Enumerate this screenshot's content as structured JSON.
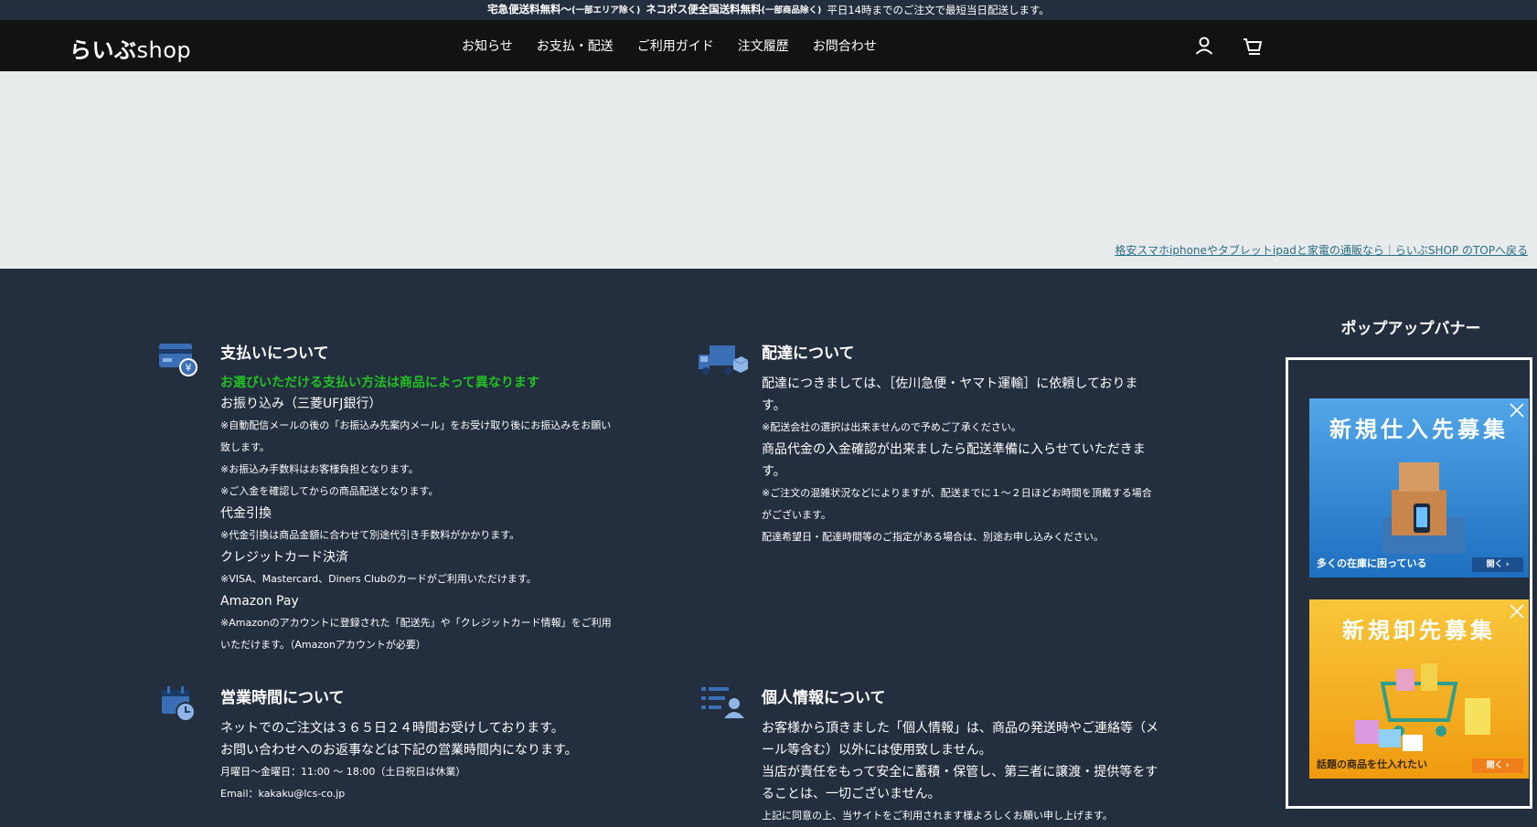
{
  "topbar": {
    "part1": "宅急便送料無料〜",
    "part1_small": "(一部エリア除く)",
    "part2": "ネコポス便全国送料無料",
    "part2_small": "(一部商品除く)",
    "part3": "平日14時までのご注文で最短当日配送します。"
  },
  "header": {
    "logo_jp": "らいぶ",
    "logo_en": "shop",
    "menu": [
      "お知らせ",
      "お支払・配送",
      "ご利用ガイド",
      "注文履歴",
      "お問合わせ"
    ],
    "icons": [
      "user-icon",
      "cart-icon"
    ]
  },
  "hero": {
    "link_text": "格安スマホiphoneやタブレットipadと家電の通販なら｜らいぶSHOP のTOPへ戻る"
  },
  "payment": {
    "title": "支払いについて",
    "highlight": "お選びいただける支払い方法は商品によって異なります",
    "bank_title": "お振り込み（三菱UFJ銀行）",
    "bank_note1a": "※自動配信メールの後の「お振込み先案内メール」をお受け取り後にお振込みをお願い",
    "bank_note1b": "致します。",
    "bank_note2": "※お振込み手数料はお客様負担となります。",
    "bank_note3": "※ご入金を確認してからの商品配送となります。",
    "cod_title": "代金引換",
    "cod_note": "※代金引換は商品金額に合わせて別途代引き手数料がかかります。",
    "card_title": "クレジットカード決済",
    "card_note": "※VISA、Mastercard、Diners Clubのカードがご利用いただけます。",
    "amazon_title": "Amazon Pay",
    "amazon_note_a": "※Amazonのアカウントに登録された「配送先」や「クレジットカード情報」をご利用",
    "amazon_note_b": "いただけます。（Amazonアカウントが必要）",
    "icon": "credit-card-yen-icon"
  },
  "delivery": {
    "title": "配達について",
    "line1a": "配達につきましては、［佐川急便・ヤマト運輸］に依頼しておりま",
    "line1b": "す。",
    "note1": "※配送会社の選択は出来ませんので予めご了承ください。",
    "line2a": "商品代金の入金確認が出来ましたら配送準備に入らせていただきま",
    "line2b": "す。",
    "note2a": "※ご注文の混雑状況などによりますが、配送までに１〜２日ほどお時間を頂戴する場合",
    "note2b": "がございます。",
    "note3": "配達希望日・配達時間等のご指定がある場合は、別途お申し込みください。",
    "icon": "truck-icon"
  },
  "hours": {
    "title": "営業時間について",
    "line1": "ネットでのご注文は３６５日２４時間お受けしております。",
    "line2": "お問い合わせへのお返事などは下記の営業時間内になります。",
    "line3": "月曜日〜金曜日：11:00 〜 18:00（土日祝日は休業）",
    "line4": "Email：kakaku@lcs-co.jp",
    "icon": "calendar-clock-icon"
  },
  "privacy": {
    "title": "個人情報について",
    "line1a": "お客様から頂きました「個人情報」は、商品の発送時やご連絡等（メ",
    "line1b": "ール等含む）以外には使用致しません。",
    "line2a": "当店が責任をもって安全に蓄積・保管し、第三者に譲渡・提供等をす",
    "line2b": "ることは、一切ございません。",
    "line3": "上記に同意の上、当サイトをご利用されます様よろしくお願い申し上げます。",
    "icon": "user-list-icon"
  },
  "popup": {
    "title": "ポップアップバナー",
    "banners": [
      {
        "title": "新規仕入先募集",
        "caption": "多くの在庫に困っている",
        "button": "開く ›",
        "color": "#2f8bd6"
      },
      {
        "title": "新規卸先募集",
        "caption": "話題の商品を仕入れたい",
        "button": "開く ›",
        "color": "#f6b11b"
      }
    ]
  },
  "colors": {
    "footer_bg": "#232e3f",
    "nav_bg": "#121212",
    "hero_bg": "#e8ebeb",
    "accent_green": "#23c023",
    "icon_blue": "#3a6fb5"
  }
}
